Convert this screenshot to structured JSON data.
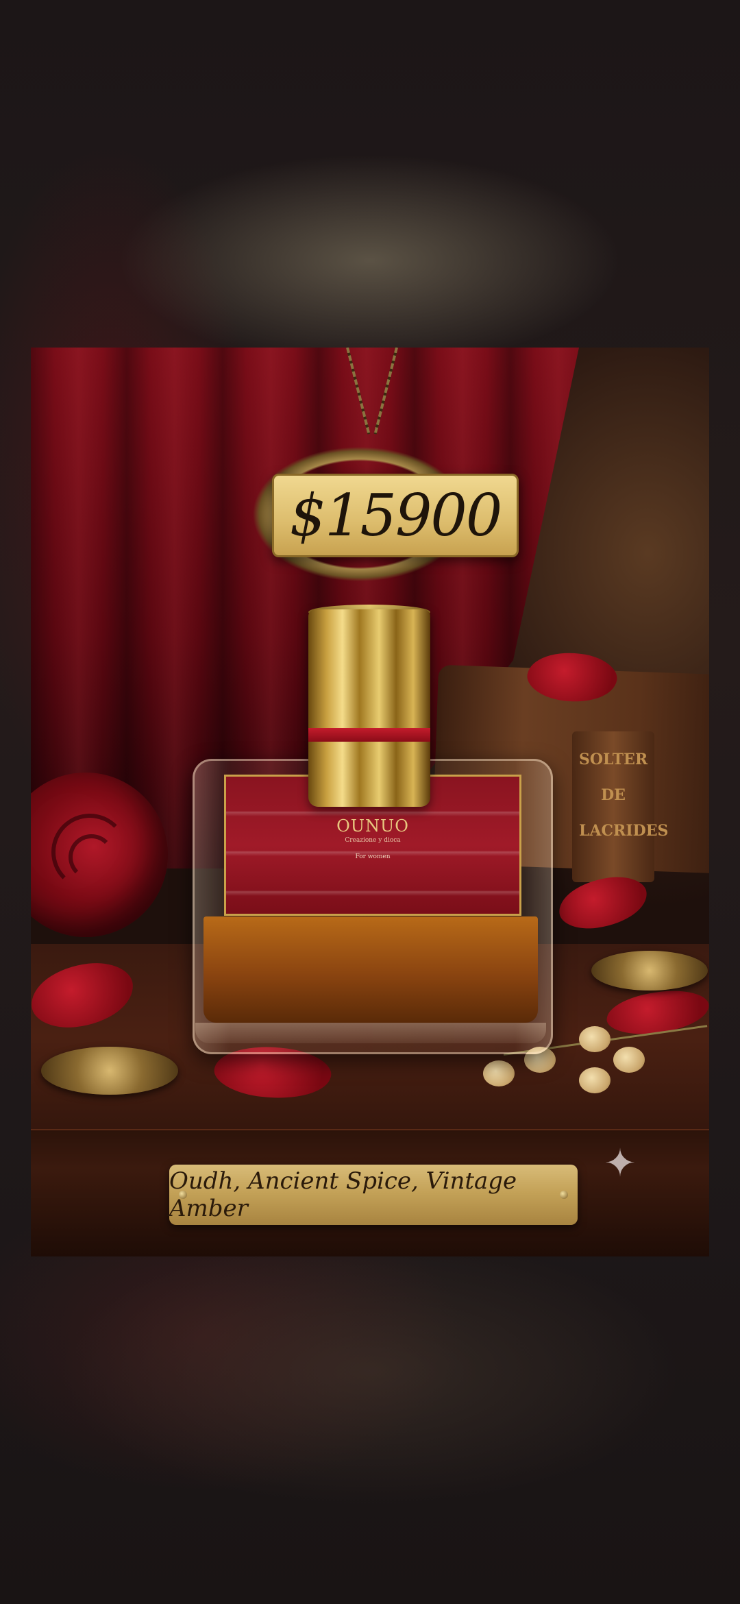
{
  "product": {
    "price": "$15900",
    "brand": "OUNUO",
    "label_subtitle": "Creazione y dioca",
    "label_for": "For women",
    "notes": "Oudh, Ancient Spice, Vintage Amber"
  },
  "book": {
    "spine_text": "SOLTER DE LACRIDES"
  },
  "icons": {
    "watermark": "sparkle-icon"
  },
  "colors": {
    "price_tag": "#e6c878",
    "label_red": "#961624",
    "gold": "#c9a14a",
    "background": "#1a1414"
  }
}
